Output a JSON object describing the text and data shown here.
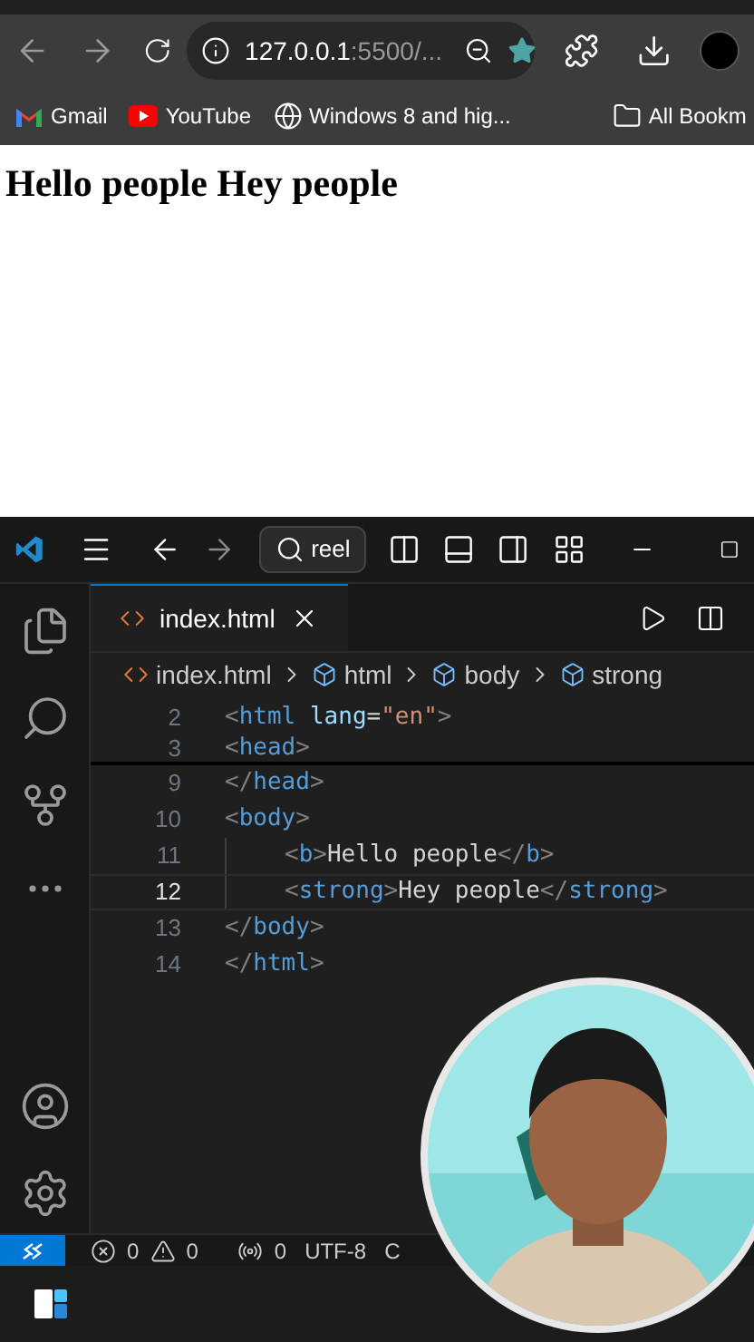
{
  "browser": {
    "url": {
      "host": "127.0.0.1",
      "rest": ":5500/..."
    },
    "bookmarks": [
      {
        "kind": "gmail",
        "label": "Gmail"
      },
      {
        "kind": "youtube",
        "label": "YouTube"
      },
      {
        "kind": "globe",
        "label": "Windows 8 and hig..."
      }
    ],
    "all_bookmarks": "All Bookm"
  },
  "page": {
    "heading": "Hello people Hey people"
  },
  "editor": {
    "search": "reel",
    "tabs": [
      {
        "label": "index.html",
        "selected": true
      }
    ],
    "breadcrumb": [
      {
        "kind": "file",
        "label": "index.html"
      },
      {
        "kind": "element",
        "label": "html"
      },
      {
        "kind": "element",
        "label": "body"
      },
      {
        "kind": "element",
        "label": "strong"
      }
    ],
    "sticky_lines": [
      {
        "number": "2",
        "current": false,
        "tokens": [
          {
            "t": "<",
            "kind": "punct"
          },
          {
            "t": "html",
            "kind": "tag"
          },
          {
            "t": " lang",
            "kind": "attr"
          },
          {
            "t": "=",
            "kind": "text"
          },
          {
            "t": "\"en\"",
            "kind": "string"
          },
          {
            "t": ">",
            "kind": "punct"
          }
        ]
      },
      {
        "number": "3",
        "current": false,
        "tokens": [
          {
            "t": "<",
            "kind": "punct"
          },
          {
            "t": "head",
            "kind": "tag"
          },
          {
            "t": ">",
            "kind": "punct"
          }
        ]
      }
    ],
    "lines": [
      {
        "number": "9",
        "current": false,
        "tokens": [
          {
            "t": "</",
            "kind": "punct"
          },
          {
            "t": "head",
            "kind": "tag"
          },
          {
            "t": ">",
            "kind": "punct"
          }
        ]
      },
      {
        "number": "10",
        "current": false,
        "tokens": [
          {
            "t": "<",
            "kind": "punct"
          },
          {
            "t": "body",
            "kind": "tag"
          },
          {
            "t": ">",
            "kind": "punct"
          }
        ],
        "children": [
          {
            "number": "11",
            "current": false,
            "tokens": [
              {
                "t": "<",
                "kind": "punct"
              },
              {
                "t": "b",
                "kind": "tag"
              },
              {
                "t": ">",
                "kind": "punct"
              },
              {
                "t": "Hello people",
                "kind": "text"
              },
              {
                "t": "</",
                "kind": "punct"
              },
              {
                "t": "b",
                "kind": "tag"
              },
              {
                "t": ">",
                "kind": "punct"
              }
            ]
          },
          {
            "number": "12",
            "current": true,
            "tokens": [
              {
                "t": "<",
                "kind": "punct"
              },
              {
                "t": "strong",
                "kind": "tag"
              },
              {
                "t": ">",
                "kind": "punct"
              },
              {
                "t": "Hey people",
                "kind": "text"
              },
              {
                "t": "</",
                "kind": "punct"
              },
              {
                "t": "strong",
                "kind": "tag"
              },
              {
                "t": ">",
                "kind": "punct"
              }
            ]
          }
        ]
      },
      {
        "number": "13",
        "current": false,
        "tokens": [
          {
            "t": "</",
            "kind": "punct"
          },
          {
            "t": "body",
            "kind": "tag"
          },
          {
            "t": ">",
            "kind": "punct"
          }
        ]
      },
      {
        "number": "14",
        "current": false,
        "tokens": [
          {
            "t": "</",
            "kind": "punct"
          },
          {
            "t": "html",
            "kind": "tag"
          },
          {
            "t": ">",
            "kind": "punct"
          }
        ]
      }
    ],
    "status": {
      "errors": "0",
      "warnings": "0",
      "ports": "0",
      "encoding": "UTF-8",
      "eol": "C"
    }
  }
}
